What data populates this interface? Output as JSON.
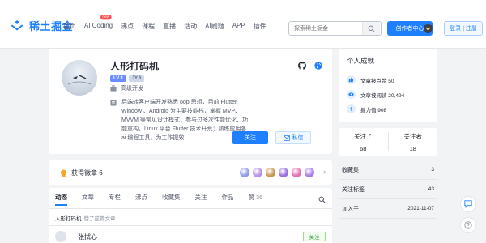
{
  "brand": {
    "logo_text": "稀土掘金",
    "accent_color": "#1e80ff"
  },
  "nav": {
    "items": [
      {
        "label": "首页"
      },
      {
        "label": "AI Coding",
        "badge": "new"
      },
      {
        "label": "沸点"
      },
      {
        "label": "课程"
      },
      {
        "label": "直播"
      },
      {
        "label": "活动"
      },
      {
        "label": "AI刷题"
      },
      {
        "label": "APP"
      },
      {
        "label": "插件"
      }
    ],
    "search_placeholder": "探索稀土掘金",
    "creator_label": "创作者中心",
    "login_label": "登录 | 注册"
  },
  "profile": {
    "username": "人形打码机",
    "level_badge": "LV.3",
    "jy_badge": "JY.6",
    "job": "高级开发",
    "intro": "后端转客户端开发熟悉 oop 思想，目前 Flutter Window 、Android 为主要技能栈，掌握 MVP、MVVM 等常见设计模式，参与过多次性能优化、功能重构，Linux 平台 Flutter 技术开荒；熟练应用各 ai 编程工具，为工作提效",
    "follow_label": "关注",
    "message_label": "私信",
    "more_label": "···"
  },
  "medals": {
    "label": "获得徽章 6",
    "count": 6,
    "colors": [
      "#8f9ce8",
      "#b78fe6",
      "#c79758",
      "#9b6fe0",
      "#e06fb3",
      "#a97de8"
    ]
  },
  "tabs": {
    "items": [
      {
        "label": "动态",
        "active": true
      },
      {
        "label": "文章"
      },
      {
        "label": "专栏"
      },
      {
        "label": "沸点"
      },
      {
        "label": "收藏集"
      },
      {
        "label": "关注"
      },
      {
        "label": "作品"
      },
      {
        "label": "赞",
        "count": "36"
      }
    ],
    "activity": {
      "user": "人形打码机",
      "action": "赞了这篇文章"
    },
    "post": {
      "author": "张拭心",
      "follow_label": "关注"
    }
  },
  "achievements": {
    "title": "个人成就",
    "items": [
      {
        "label": "文章被点赞 50"
      },
      {
        "label": "文章被阅读 20,494"
      },
      {
        "label": "掘力值 908"
      }
    ]
  },
  "follow_stats": {
    "following_label": "关注了",
    "following_value": "68",
    "followers_label": "关注者",
    "followers_value": "18"
  },
  "meta": {
    "rows": [
      {
        "label": "收藏集",
        "value": "3"
      },
      {
        "label": "关注标签",
        "value": "43"
      },
      {
        "label": "加入于",
        "value": "2021-11-07"
      }
    ]
  }
}
